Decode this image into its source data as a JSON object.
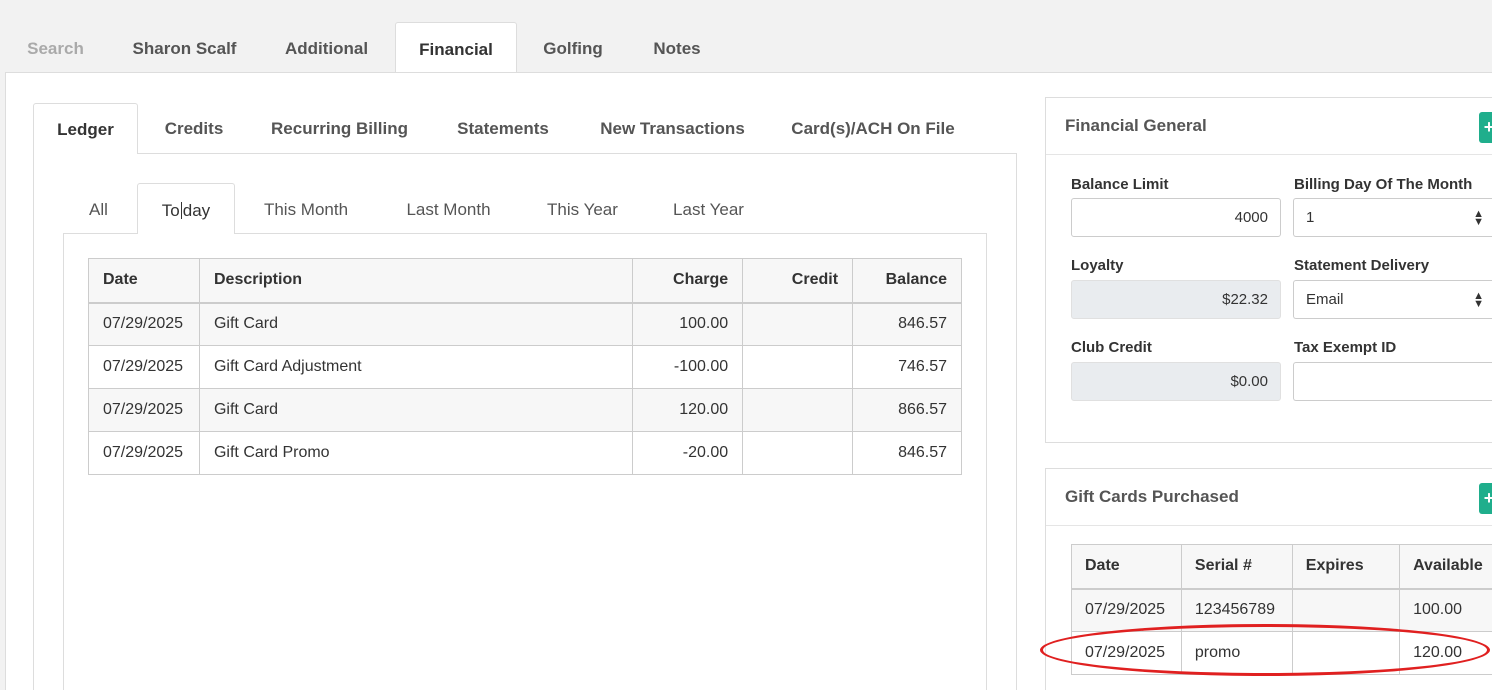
{
  "top_tabs": [
    {
      "label": "Search"
    },
    {
      "label": "Sharon Scalf"
    },
    {
      "label": "Additional"
    },
    {
      "label": "Financial"
    },
    {
      "label": "Golfing"
    },
    {
      "label": "Notes"
    }
  ],
  "sub_tabs": [
    {
      "label": "Ledger"
    },
    {
      "label": "Credits"
    },
    {
      "label": "Recurring Billing"
    },
    {
      "label": "Statements"
    },
    {
      "label": "New Transactions"
    },
    {
      "label": "Card(s)/ACH On File"
    }
  ],
  "range_tabs": {
    "all": "All",
    "today_a": "To",
    "today_b": "day",
    "this_month": "This Month",
    "last_month": "Last Month",
    "this_year": "This Year",
    "last_year": "Last Year"
  },
  "ledger": {
    "headers": {
      "date": "Date",
      "description": "Description",
      "charge": "Charge",
      "credit": "Credit",
      "balance": "Balance"
    },
    "rows": [
      {
        "date": "07/29/2025",
        "description": "Gift Card",
        "charge": "100.00",
        "credit": "",
        "balance": "846.57"
      },
      {
        "date": "07/29/2025",
        "description": "Gift Card Adjustment",
        "charge": "-100.00",
        "credit": "",
        "balance": "746.57"
      },
      {
        "date": "07/29/2025",
        "description": "Gift Card",
        "charge": "120.00",
        "credit": "",
        "balance": "866.57"
      },
      {
        "date": "07/29/2025",
        "description": "Gift Card Promo",
        "charge": "-20.00",
        "credit": "",
        "balance": "846.57"
      }
    ]
  },
  "financial_general": {
    "title": "Financial General",
    "balance_limit": {
      "label": "Balance Limit",
      "value": "4000"
    },
    "billing_day": {
      "label": "Billing Day Of The Month",
      "value": "1"
    },
    "loyalty": {
      "label": "Loyalty",
      "value": "$22.32"
    },
    "statement_delivery": {
      "label": "Statement Delivery",
      "value": "Email"
    },
    "club_credit": {
      "label": "Club Credit",
      "value": "$0.00"
    },
    "tax_exempt": {
      "label": "Tax Exempt ID",
      "value": ""
    }
  },
  "gift_cards": {
    "title": "Gift Cards Purchased",
    "headers": {
      "date": "Date",
      "serial": "Serial #",
      "expires": "Expires",
      "available": "Available"
    },
    "rows": [
      {
        "date": "07/29/2025",
        "serial": "123456789",
        "expires": "",
        "available": "100.00"
      },
      {
        "date": "07/29/2025",
        "serial": "promo",
        "expires": "",
        "available": "120.00"
      }
    ]
  },
  "colors": {
    "accent_green": "#1fae8c",
    "highlight_red": "#e02020"
  },
  "icons": {
    "add": "plus-icon",
    "select": "select-arrows-icon"
  }
}
